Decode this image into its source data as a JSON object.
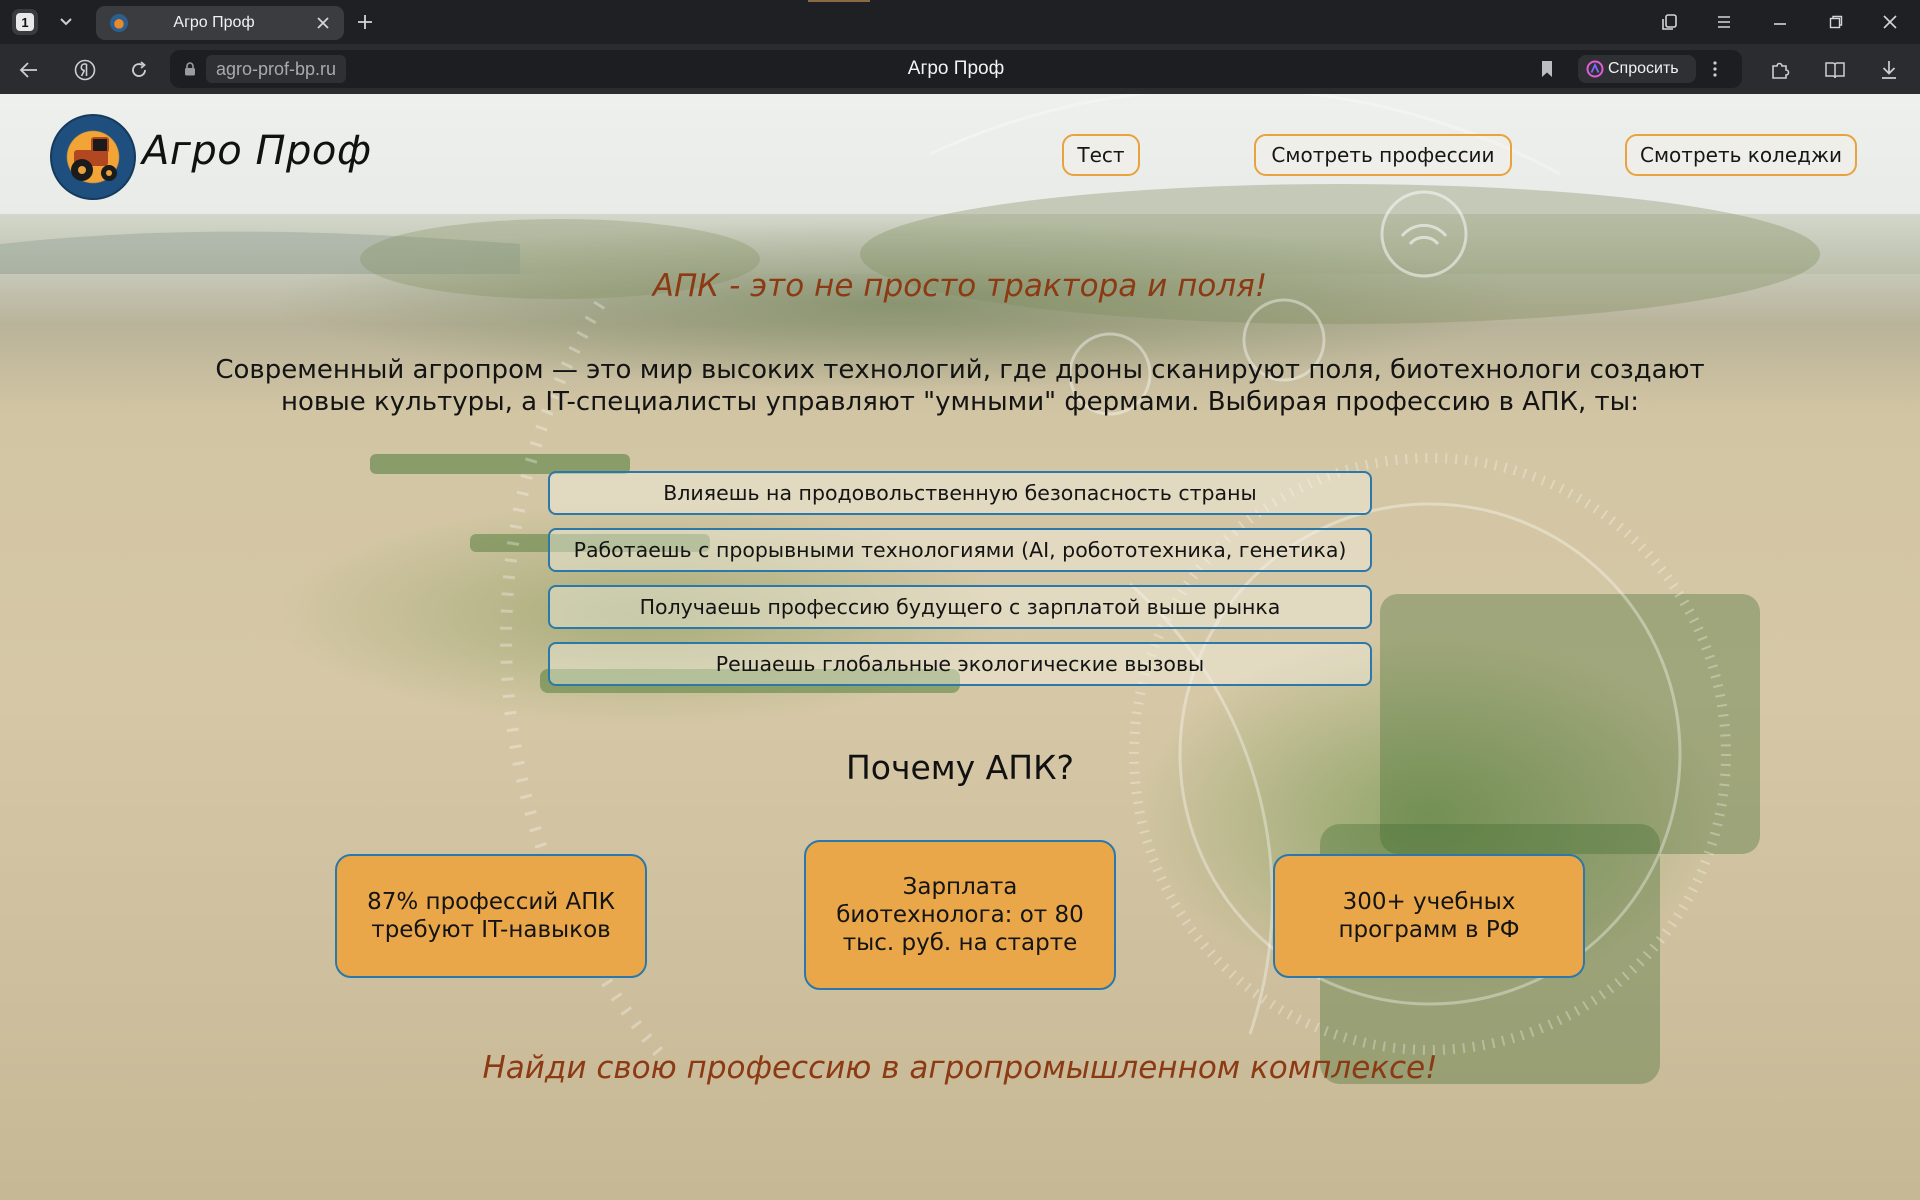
{
  "browser": {
    "tab_count": "1",
    "tab_title": "Агро Проф",
    "url": "agro-prof-bp.ru",
    "page_title": "Агро Проф",
    "ask_label": "Спросить"
  },
  "header": {
    "brand": "Агро Проф",
    "nav": {
      "test": "Тест",
      "professions": "Смотреть профессии",
      "colleges": "Смотреть коледжи"
    }
  },
  "hero": {
    "title": "АПК - это не просто трактора и поля!",
    "intro": "Современный агропром — это мир высоких технологий, где дроны сканируют поля, биотехнологи создают новые культуры, а IT-специалисты управляют \"умными\" фермами. Выбирая профессию в АПК, ты:"
  },
  "benefits": [
    "Влияешь на продовольственную безопасность страны",
    "Работаешь с прорывными технологиями (AI, робототехника, генетика)",
    "Получаешь профессию будущего с зарплатой выше рынка",
    "Решаешь глобальные экологические вызовы"
  ],
  "why": {
    "title": "Почему АПК?",
    "stats": [
      "87% профессий АПК требуют IT-навыков",
      "Зарплата биотехнолога: от 80 тыс. руб. на старте",
      "300+ учебных программ в РФ"
    ]
  },
  "cta": "Найди свою профессию в агропромышленном комплексе!",
  "colors": {
    "accent_orange": "#e9a74a",
    "border_blue": "#2c78a8",
    "heading_brown": "#8c3a14",
    "chrome_dark": "#1f2023"
  }
}
